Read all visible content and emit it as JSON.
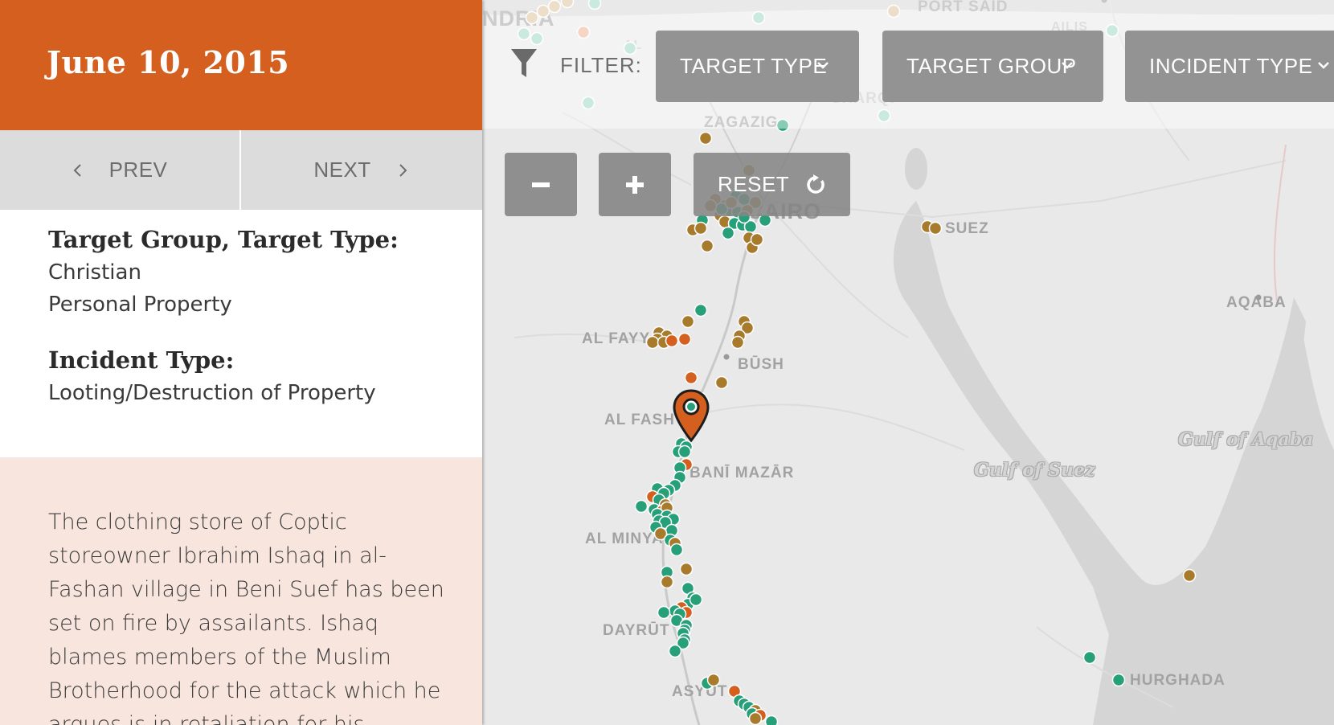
{
  "sidebar": {
    "date": "June 10, 2015",
    "prev_label": "PREV",
    "next_label": "NEXT",
    "target_heading": "Target Group, Target Type:",
    "target_group": "Christian",
    "target_type": "Personal Property",
    "incident_heading": "Incident Type:",
    "incident_type": "Looting/Destruction of Property",
    "description": "The clothing store of Coptic storeowner Ibrahim Ishaq in al-Fashan village in Beni Suef has been set on fire by assailants. Ishaq blames members of the Muslim Brotherhood for the attack which he argues is in retaliation for his"
  },
  "filter": {
    "label": "FILTER:",
    "buttons": [
      "TARGET TYPE",
      "TARGET GROUP",
      "INCIDENT TYPE"
    ]
  },
  "zoom": {
    "reset_label": "RESET"
  },
  "map": {
    "places": {
      "alexandria": "NDRIA",
      "port_said": "PORT SAID",
      "ismailia": "AILIS",
      "zagazig": "ZAGAZIG",
      "cairo": "CAIRO",
      "suez": "SUEZ",
      "aqaba": "AQABA",
      "fayyum": "AL FAYY",
      "bush": "BŪSH",
      "fashn": "AL FASH",
      "bani_mazar": "BANĪ MAZĀR",
      "minya": "AL MINYA",
      "dayrut": "DAYRŪT",
      "asyut": "ASYŪT",
      "hurghada": "HURGHADA",
      "shariqiya": "SHARQĪ",
      "al": "AL"
    },
    "seas": {
      "gulf_of_suez": "Gulf of Suez",
      "gulf_of_aqaba": "Gulf of Aqaba"
    },
    "colors": {
      "teal": "#27a07a",
      "orange": "#d45f1e",
      "brown": "#a87a2b",
      "light_teal": "#9fd9c5",
      "light_orange": "#eeb394",
      "light_brown": "#dcc39b"
    },
    "selected_marker": "map-pin-icon"
  }
}
